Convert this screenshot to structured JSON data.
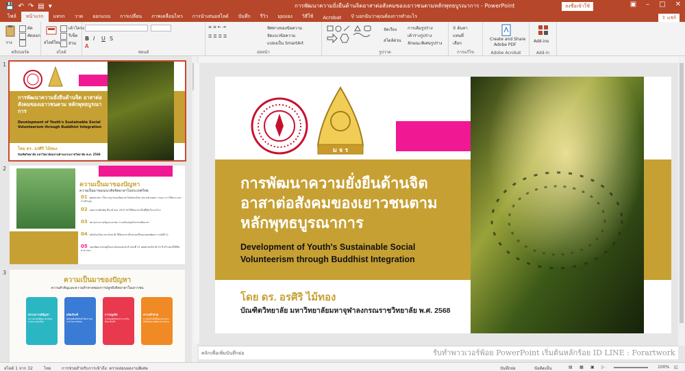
{
  "window": {
    "title": "การพัฒนาความยั่งยืนด้านจิตอาสาต่อสังคมของเยาวชนตามหลักพุทธบูรณาการ - PowerPoint",
    "signin_label": "ลงชื่อเข้าใช้",
    "share_label": "แชร์"
  },
  "tabs": [
    "ไฟล์",
    "หน้าแรก",
    "แทรก",
    "วาด",
    "ออกแบบ",
    "การเปลี่ยน",
    "ภาพเคลื่อนไหว",
    "การนำเสนอสไลด์",
    "บันทึก",
    "รีวิว",
    "มุมมอง",
    "วิธีใช้",
    "Acrobat"
  ],
  "tell_me": "บอกฉันว่าคุณต้องการทำอะไร",
  "ribbon": {
    "clipboard": {
      "label": "คลิปบอร์ด",
      "paste": "วาง",
      "cut": "ตัด",
      "copy": "คัดลอก",
      "format": "ตัวคัดวางรูปแบบ"
    },
    "slides": {
      "label": "สไลด์",
      "new": "สไลด์ใหม่",
      "layout": "เค้าโครง",
      "reset": "รีเซ็ต",
      "section": "ส่วน"
    },
    "font": {
      "label": "ฟอนต์"
    },
    "paragraph": {
      "label": "ย่อหน้า",
      "direction": "ทิศทางของข้อความ",
      "align": "จัดแนวข้อความ",
      "smartart": "แปลงเป็น SmartArt"
    },
    "drawing": {
      "label": "รูปวาด",
      "arrange": "จัดเรียง",
      "quick_styles": "สไตล์ด่วน",
      "fill": "การเติมรูปร่าง",
      "outline": "เค้าร่างรูปร่าง",
      "effects": "ลักษณะพิเศษรูปร่าง"
    },
    "editing": {
      "label": "การแก้ไข",
      "find": "ค้นหา",
      "replace": "แทนที่",
      "select": "เลือก"
    },
    "acrobat": {
      "label": "Adobe Acrobat",
      "button_line1": "Create and Share",
      "button_line2": "Adobe PDF"
    },
    "addins": {
      "label": "Add-in",
      "button": "Add-ins"
    }
  },
  "thumbnails": {
    "s1": {
      "num": "1",
      "title": "การพัฒนาความยั่งยืนด้านจิต อาสาต่อสังคมของเยาวชนตาม หลักพุทธบูรณาการ",
      "subtitle": "Development of Youth's Sustainable Social Volunteerism through Buddhist Integration",
      "author": "โดย ดร. อรศิริ ไม้ทอง",
      "affil": "บัณฑิตวิทยาลัย มหาวิทยาลัยมหาจุฬาลงกรณราชวิทยาลัย พ.ศ. 2568"
    },
    "s2": {
      "num": "2",
      "title": "ความเป็นมาของปัญหา",
      "subtitle": "ความเป็นมาของแนวคิดจิตอาสาในประเทศไทย",
      "items": [
        {
          "num": "01",
          "text": "พุทธศาสนา เป็นรากฐานของจิตอาสาในสังคมไทย เช่น หลักเมตตา กรุณา การให้ทาน และการทำบุญ"
        },
        {
          "num": "02",
          "text": "เหตุการณ์สำคัญ สึนามิ พ.ศ. 2547 ทำให้จิตอาสาเป็นที่รู้จักในวงกว้าง"
        },
        {
          "num": "03",
          "text": "หน่วยงานภาครัฐและเอกชน ร่วมสนับสนุนกิจกรรมจิตอาสา"
        },
        {
          "num": "04",
          "text": "ผลักดันนโยบายระดับชาติ ให้จิตอาสาเป็นส่วนหนึ่งของแผนพัฒนาฯ ฉบับที่ 11"
        },
        {
          "num": "05",
          "text": "แผนพัฒนาเศรษฐกิจและสังคมแห่งชาติ ฉบับที่ 12 ยุทธศาสตร์ชาติ 20 ปี สร้างคนให้มีจิตสาธารณะ"
        }
      ]
    },
    "s3": {
      "num": "3",
      "title": "ความเป็นมาของปัญหา",
      "subtitle": "ความสำคัญและความท้าทายของการปลูกฝังจิตอาสาในเยาวชน",
      "cards": [
        {
          "head": "สถานการณ์ปัญหา",
          "body": "เยาวชนไทยมีจิตอาสาลดลง ขาดความต่อเนื่อง"
        },
        {
          "head": "ผลิตภัณฑ์",
          "body": "อิทธิพลสื่อดิจิทัลทำให้เยาวชนห่างไกลจากสังคม"
        },
        {
          "head": "การปลูกฝัง",
          "body": "การปลูกฝังจิตอาสา ควรเริ่มตั้งแต่วัยเด็ก"
        },
        {
          "head": "ความท้าทาย",
          "body": "การส่งเสริมให้มีจิตอาสาอย่างยั่งยืนต้องอาศัยหลายภาคส่วน"
        }
      ]
    }
  },
  "slide": {
    "title_lines": [
      "การพัฒนาความยั่งยืนด้านจิต",
      "อาสาต่อสังคมของเยาวชนตาม",
      "หลักพุทธบูรณาการ"
    ],
    "subtitle_lines": [
      "Development of Youth's Sustainable Social",
      "Volunteerism through Buddhist Integration"
    ],
    "author": "โดย ดร. อรศิริ ไม้ทอง",
    "affiliation": "บัณฑิตวิทยาลัย มหาวิทยาลัยมหาจุฬาลงกรณราชวิทยาลัย พ.ศ. 2568",
    "seal_text": "ม จ ร",
    "colors": {
      "gold": "#c7a033",
      "pink": "#f11893",
      "red": "#c8102e",
      "accent": "#b7472a"
    }
  },
  "notes_placeholder": "คลิกเพื่อเพิ่มบันทึกย่อ",
  "watermark": "รับทำพาวเวอร์พ้อย PowerPoint เริ่มต้นหลักร้อย ID LINE : Forartwork",
  "status": {
    "slide_count": "สไลด์ 1 จาก 32",
    "language": "ไทย",
    "accessibility": "การช่วยสำหรับการเข้าถึง: ตรวจสอบผลงานพิเศษ",
    "notes_btn": "บันทึกย่อ",
    "comments_btn": "ข้อคิดเห็น",
    "zoom": "100%"
  }
}
